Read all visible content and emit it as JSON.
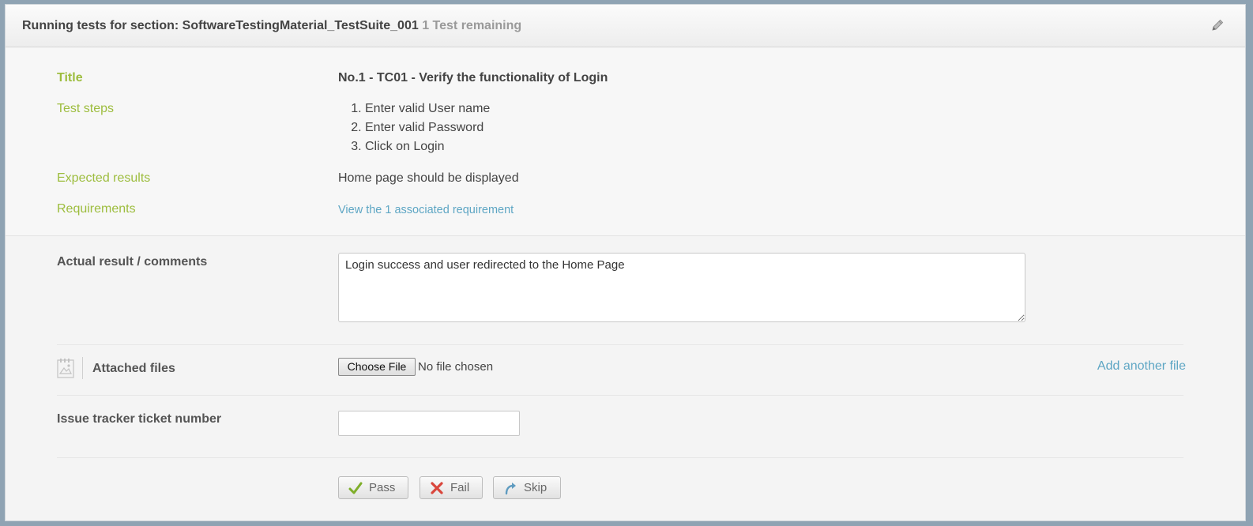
{
  "header": {
    "title": "Running tests for section: SoftwareTestingMaterial_TestSuite_001",
    "remaining": "1 Test remaining",
    "edit_icon": "pencil-icon"
  },
  "case": {
    "title_label": "Title",
    "title_value": "No.1 - TC01 - Verify the functionality of Login",
    "steps_label": "Test steps",
    "steps": [
      "Enter valid User name",
      "Enter valid Password",
      "Click on Login"
    ],
    "expected_label": "Expected results",
    "expected_value": "Home page should be displayed",
    "requirements_label": "Requirements",
    "requirements_link": "View the 1 associated requirement"
  },
  "form": {
    "comments_label": "Actual result / comments",
    "comments_value": "Login success and user redirected to the Home Page",
    "attached_label": "Attached files",
    "attach_icon": "image-attachment-icon",
    "choose_file": "Choose File",
    "no_file": "No file chosen",
    "add_another": "Add another file",
    "ticket_label": "Issue tracker ticket number",
    "ticket_value": ""
  },
  "actions": {
    "pass": "Pass",
    "fail": "Fail",
    "skip": "Skip"
  },
  "colors": {
    "label_green": "#9dbd3e",
    "link_blue": "#5ea6c4",
    "pass_check": "#7fae2a",
    "fail_x": "#d9463c",
    "skip_arrow": "#5e9bc0"
  }
}
